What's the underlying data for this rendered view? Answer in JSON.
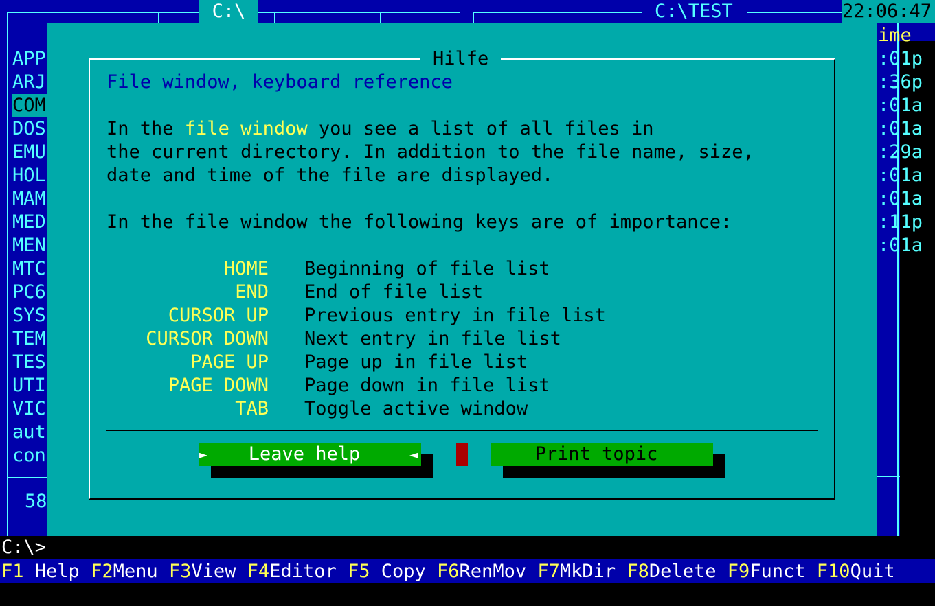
{
  "left_panel": {
    "path": "C:\\",
    "files": [
      "APP",
      "ARJ",
      "COM",
      "DOS",
      "EMU",
      "HOL",
      "MAM",
      "MED",
      "MEN",
      "MTC",
      "PC6",
      "SYS",
      "TEM",
      "TES",
      "UTI",
      "VIC",
      "aut",
      "con"
    ],
    "status": "58"
  },
  "right_panel": {
    "path": "C:\\TEST",
    "clock": "22:06:47",
    "col_header": "ime",
    "times": [
      ":01p",
      ":36p",
      ":01a",
      ":01a",
      ":29a",
      ":01a",
      ":01a",
      ":11p",
      ":01a"
    ]
  },
  "help": {
    "title": "Hilfe",
    "subtitle": "File window, keyboard reference",
    "para1_pre": "In the ",
    "para1_hl": "file window",
    "para1_post": " you see a list of all files in",
    "para1_line2": "the current directory. In addition to the file name, size,",
    "para1_line3": "date and time of the file are displayed.",
    "para2": "In the file window the following keys are of importance:",
    "keys": [
      {
        "key": "HOME",
        "desc": "Beginning of file list"
      },
      {
        "key": "END",
        "desc": "End of file list"
      },
      {
        "key": "CURSOR UP",
        "desc": "Previous entry in file list"
      },
      {
        "key": "CURSOR DOWN",
        "desc": "Next entry in file list"
      },
      {
        "key": "PAGE UP",
        "desc": "Page up in file list"
      },
      {
        "key": "PAGE DOWN",
        "desc": "Page down in file list"
      },
      {
        "key": "TAB",
        "desc": "Toggle active window"
      }
    ],
    "btn_leave": "Leave help",
    "btn_print": "Print topic",
    "arrow_left": "►",
    "arrow_right": "◄"
  },
  "cmd_prompt": "C:\\>",
  "fkeys": [
    {
      "num": "F1",
      "label": " Help "
    },
    {
      "num": "F2",
      "label": "Menu "
    },
    {
      "num": "F3",
      "label": "View "
    },
    {
      "num": "F4",
      "label": "Editor "
    },
    {
      "num": "F5",
      "label": " Copy "
    },
    {
      "num": "F6",
      "label": "RenMov "
    },
    {
      "num": "F7",
      "label": "MkDir "
    },
    {
      "num": "F8",
      "label": "Delete "
    },
    {
      "num": "F9",
      "label": "Funct "
    },
    {
      "num": "F10",
      "label": "Quit"
    }
  ],
  "colors": {
    "panel_bg": "#0000aa",
    "dialog_bg": "#00aaaa",
    "button_bg": "#00aa00",
    "key_color": "#ffff55"
  }
}
